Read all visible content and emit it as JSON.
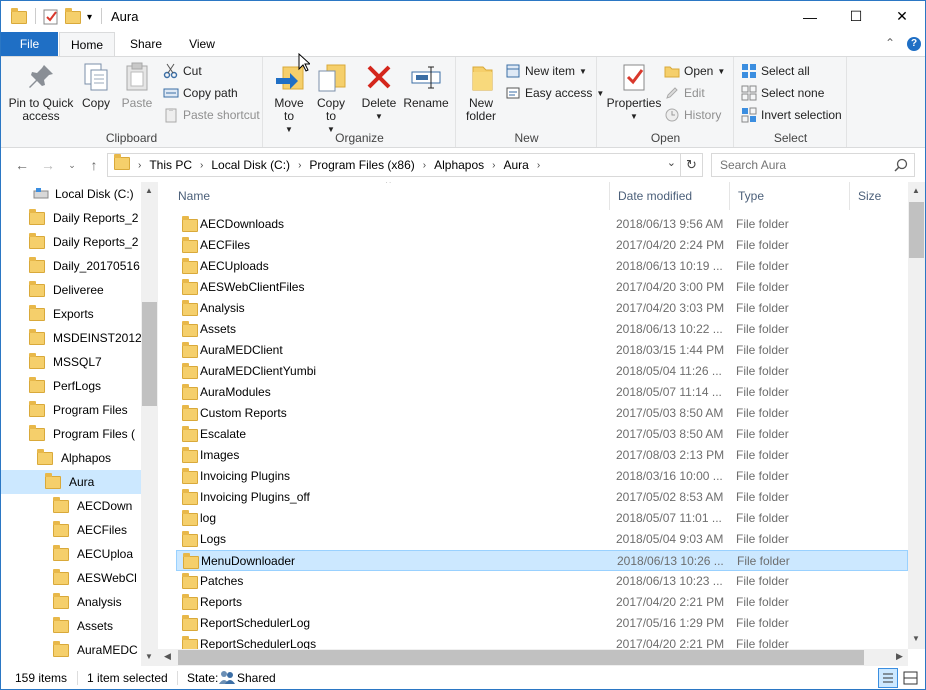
{
  "window": {
    "title": "Aura",
    "controls": {
      "minimize": "—",
      "maximize": "☐",
      "close": "✕"
    }
  },
  "ribbon_tabs": [
    "File",
    "Home",
    "Share",
    "View"
  ],
  "ribbon": {
    "clipboard": {
      "label": "Clipboard",
      "pin": "Pin to Quick access",
      "copy": "Copy",
      "paste": "Paste",
      "cut": "Cut",
      "copy_path": "Copy path",
      "paste_shortcut": "Paste shortcut"
    },
    "organize": {
      "label": "Organize",
      "move_to": "Move to",
      "copy_to": "Copy to",
      "delete": "Delete",
      "rename": "Rename"
    },
    "new": {
      "label": "New",
      "new_folder": "New folder",
      "new_item": "New item",
      "easy_access": "Easy access"
    },
    "open": {
      "label": "Open",
      "properties": "Properties",
      "open": "Open",
      "edit": "Edit",
      "history": "History"
    },
    "select": {
      "label": "Select",
      "select_all": "Select all",
      "select_none": "Select none",
      "invert": "Invert selection"
    }
  },
  "address": {
    "breadcrumbs": [
      "This PC",
      "Local Disk (C:)",
      "Program Files (x86)",
      "Alphapos",
      "Aura"
    ],
    "search_placeholder": "Search Aura"
  },
  "nav_tree": [
    {
      "label": "Local Disk (C:)",
      "indent": 0,
      "drive": true
    },
    {
      "label": "Daily Reports_2",
      "indent": 1
    },
    {
      "label": "Daily Reports_2",
      "indent": 1
    },
    {
      "label": "Daily_20170516",
      "indent": 1
    },
    {
      "label": "Deliveree",
      "indent": 1
    },
    {
      "label": "Exports",
      "indent": 1
    },
    {
      "label": "MSDEINST2012",
      "indent": 1
    },
    {
      "label": "MSSQL7",
      "indent": 1
    },
    {
      "label": "PerfLogs",
      "indent": 1
    },
    {
      "label": "Program Files",
      "indent": 1
    },
    {
      "label": "Program Files (",
      "indent": 1
    },
    {
      "label": "Alphapos",
      "indent": 2
    },
    {
      "label": "Aura",
      "indent": 3,
      "selected": true
    },
    {
      "label": "AECDown",
      "indent": 4
    },
    {
      "label": "AECFiles",
      "indent": 4
    },
    {
      "label": "AECUploa",
      "indent": 4
    },
    {
      "label": "AESWebCl",
      "indent": 4
    },
    {
      "label": "Analysis",
      "indent": 4
    },
    {
      "label": "Assets",
      "indent": 4
    },
    {
      "label": "AuraMEDC",
      "indent": 4
    }
  ],
  "columns": {
    "name": "Name",
    "date": "Date modified",
    "type": "Type",
    "size": "Size"
  },
  "files": [
    {
      "name": "AECDownloads",
      "date": "2018/06/13 9:56 AM",
      "type": "File folder"
    },
    {
      "name": "AECFiles",
      "date": "2017/04/20 2:24 PM",
      "type": "File folder"
    },
    {
      "name": "AECUploads",
      "date": "2018/06/13 10:19 ...",
      "type": "File folder"
    },
    {
      "name": "AESWebClientFiles",
      "date": "2017/04/20 3:00 PM",
      "type": "File folder"
    },
    {
      "name": "Analysis",
      "date": "2017/04/20 3:03 PM",
      "type": "File folder"
    },
    {
      "name": "Assets",
      "date": "2018/06/13 10:22 ...",
      "type": "File folder"
    },
    {
      "name": "AuraMEDClient",
      "date": "2018/03/15 1:44 PM",
      "type": "File folder"
    },
    {
      "name": "AuraMEDClientYumbi",
      "date": "2018/05/04 11:26 ...",
      "type": "File folder"
    },
    {
      "name": "AuraModules",
      "date": "2018/05/07 11:14 ...",
      "type": "File folder"
    },
    {
      "name": "Custom Reports",
      "date": "2017/05/03 8:50 AM",
      "type": "File folder"
    },
    {
      "name": "Escalate",
      "date": "2017/05/03 8:50 AM",
      "type": "File folder"
    },
    {
      "name": "Images",
      "date": "2017/08/03 2:13 PM",
      "type": "File folder"
    },
    {
      "name": "Invoicing Plugins",
      "date": "2018/03/16 10:00 ...",
      "type": "File folder"
    },
    {
      "name": "Invoicing Plugins_off",
      "date": "2017/05/02 8:53 AM",
      "type": "File folder"
    },
    {
      "name": "log",
      "date": "2018/05/07 11:01 ...",
      "type": "File folder"
    },
    {
      "name": "Logs",
      "date": "2018/05/04 9:03 AM",
      "type": "File folder"
    },
    {
      "name": "MenuDownloader",
      "date": "2018/06/13 10:26 ...",
      "type": "File folder",
      "selected": true
    },
    {
      "name": "Patches",
      "date": "2018/06/13 10:23 ...",
      "type": "File folder"
    },
    {
      "name": "Reports",
      "date": "2017/04/20 2:21 PM",
      "type": "File folder"
    },
    {
      "name": "ReportSchedulerLog",
      "date": "2017/05/16 1:29 PM",
      "type": "File folder"
    },
    {
      "name": "ReportSchedulerLogs",
      "date": "2017/04/20 2:21 PM",
      "type": "File folder"
    }
  ],
  "status": {
    "items": "159 items",
    "selected": "1 item selected",
    "state_label": "State:",
    "state_value": "Shared"
  }
}
